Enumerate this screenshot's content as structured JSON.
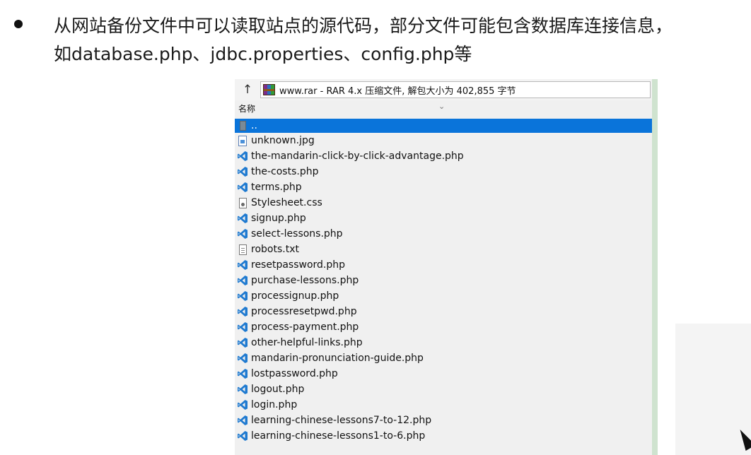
{
  "slide": {
    "line1": "从网站备份文件中可以读取站点的源代码，部分文件可能包含数据库连接信息，",
    "line2": "如database.php、jdbc.properties、config.php等"
  },
  "explorer": {
    "up_button": "↑",
    "address": "www.rar - RAR 4.x 压缩文件, 解包大小为 402,855 字节",
    "column_name": "名称",
    "files": [
      {
        "name": "..",
        "icon": "folder-up-icon",
        "selected": true
      },
      {
        "name": "unknown.jpg",
        "icon": "image-file-icon"
      },
      {
        "name": "the-mandarin-click-by-click-advantage.php",
        "icon": "vscode-icon"
      },
      {
        "name": "the-costs.php",
        "icon": "vscode-icon"
      },
      {
        "name": "terms.php",
        "icon": "vscode-icon"
      },
      {
        "name": "Stylesheet.css",
        "icon": "css-file-icon"
      },
      {
        "name": "signup.php",
        "icon": "vscode-icon"
      },
      {
        "name": "select-lessons.php",
        "icon": "vscode-icon"
      },
      {
        "name": "robots.txt",
        "icon": "text-file-icon"
      },
      {
        "name": "resetpassword.php",
        "icon": "vscode-icon"
      },
      {
        "name": "purchase-lessons.php",
        "icon": "vscode-icon"
      },
      {
        "name": "processignup.php",
        "icon": "vscode-icon"
      },
      {
        "name": "processresetpwd.php",
        "icon": "vscode-icon"
      },
      {
        "name": "process-payment.php",
        "icon": "vscode-icon"
      },
      {
        "name": "other-helpful-links.php",
        "icon": "vscode-icon"
      },
      {
        "name": "mandarin-pronunciation-guide.php",
        "icon": "vscode-icon"
      },
      {
        "name": "lostpassword.php",
        "icon": "vscode-icon"
      },
      {
        "name": "logout.php",
        "icon": "vscode-icon"
      },
      {
        "name": "login.php",
        "icon": "vscode-icon"
      },
      {
        "name": "learning-chinese-lessons7-to-12.php",
        "icon": "vscode-icon"
      },
      {
        "name": "learning-chinese-lessons1-to-6.php",
        "icon": "vscode-icon"
      }
    ]
  },
  "colors": {
    "selection": "#0a74da",
    "vscode_blue": "#1f7ad0",
    "frame_green": "#cfe3cf"
  }
}
